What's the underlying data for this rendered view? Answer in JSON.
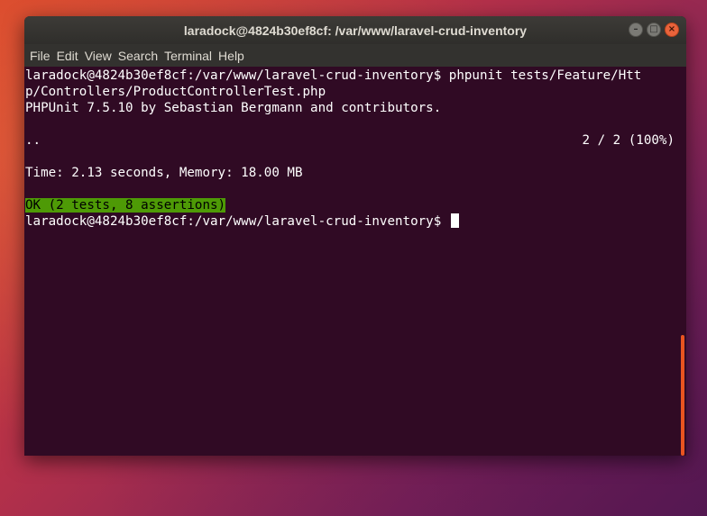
{
  "window": {
    "title": "laradock@4824b30ef8cf: /var/www/laravel-crud-inventory"
  },
  "menubar": {
    "items": [
      "File",
      "Edit",
      "View",
      "Search",
      "Terminal",
      "Help"
    ]
  },
  "terminal": {
    "lines": [
      "laradock@4824b30ef8cf:/var/www/laravel-crud-inventory$ phpunit tests/Feature/Htt",
      "p/Controllers/ProductControllerTest.php",
      "PHPUnit 7.5.10 by Sebastian Bergmann and contributors.",
      ""
    ],
    "progress_dots": "..",
    "progress_count": "2 / 2 (100%)",
    "time_line": "Time: 2.13 seconds, Memory: 18.00 MB",
    "ok_line": "OK (2 tests, 8 assertions)",
    "prompt": "laradock@4824b30ef8cf:/var/www/laravel-crud-inventory$ "
  },
  "colors": {
    "terminal_bg": "#300a24",
    "ok_bg": "#4e9a06",
    "scrollbar": "#e95420"
  }
}
